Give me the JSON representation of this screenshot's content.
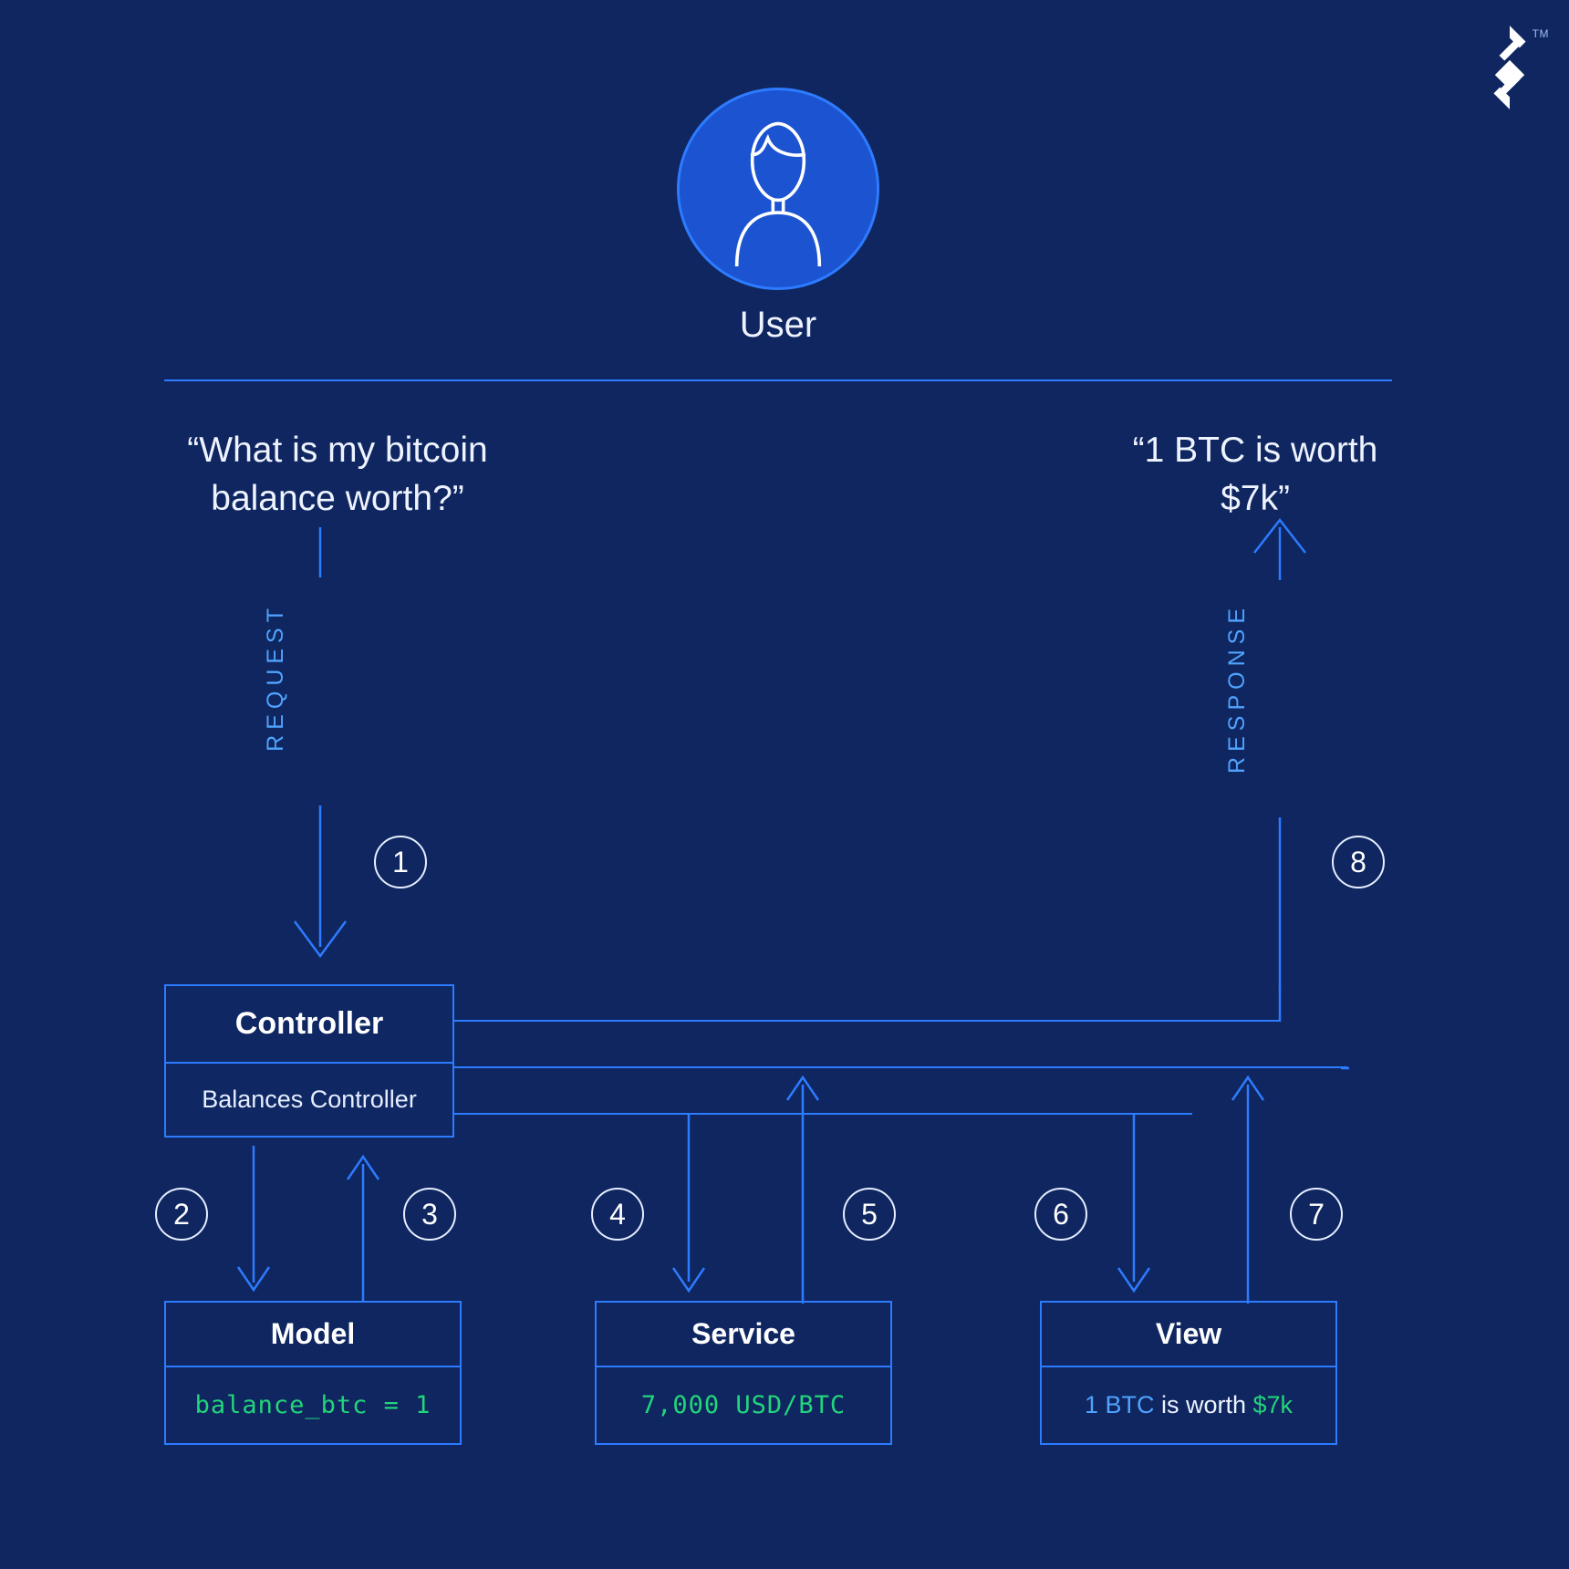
{
  "brand": {
    "tm": "TM"
  },
  "user": {
    "label": "User"
  },
  "question": {
    "text": "“What is my bitcoin balance worth?”"
  },
  "answer": {
    "text": "“1 BTC is worth $7k”"
  },
  "flow": {
    "request_label": "REQUEST",
    "response_label": "RESPONSE",
    "steps": {
      "s1": "1",
      "s2": "2",
      "s3": "3",
      "s4": "4",
      "s5": "5",
      "s6": "6",
      "s7": "7",
      "s8": "8"
    }
  },
  "controller": {
    "title": "Controller",
    "subtitle": "Balances Controller"
  },
  "model": {
    "title": "Model",
    "body": "balance_btc = 1"
  },
  "service": {
    "title": "Service",
    "body": "7,000 USD/BTC"
  },
  "view": {
    "title": "View",
    "prefix": "1 BTC",
    "mid": " is worth ",
    "suffix": "$7k"
  }
}
